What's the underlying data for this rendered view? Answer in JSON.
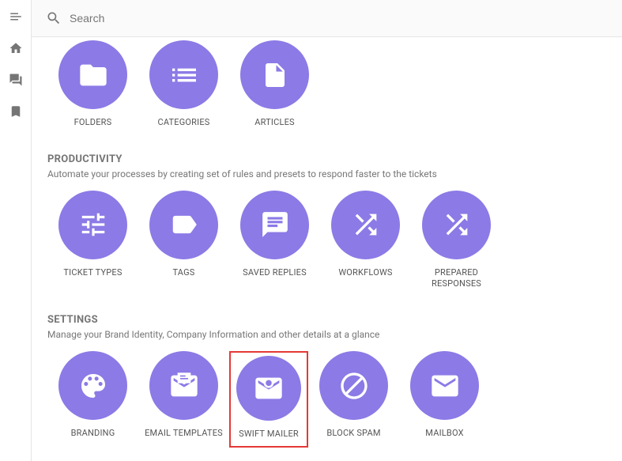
{
  "search": {
    "placeholder": "Search"
  },
  "colors": {
    "accent": "#8c7ae6",
    "highlight": "#e53935"
  },
  "top_tiles": [
    {
      "label": "FOLDERS",
      "icon": "folder-icon"
    },
    {
      "label": "CATEGORIES",
      "icon": "list-icon"
    },
    {
      "label": "ARTICLES",
      "icon": "file-icon"
    }
  ],
  "productivity": {
    "title": "PRODUCTIVITY",
    "subtitle": "Automate your processes by creating set of rules and presets to respond faster to the tickets",
    "tiles": [
      {
        "label": "TICKET TYPES",
        "icon": "sliders-icon"
      },
      {
        "label": "TAGS",
        "icon": "tag-icon"
      },
      {
        "label": "SAVED REPLIES",
        "icon": "chat-icon"
      },
      {
        "label": "WORKFLOWS",
        "icon": "shuffle-icon"
      },
      {
        "label": "PREPARED RESPONSES",
        "icon": "shuffle-icon"
      }
    ]
  },
  "settings": {
    "title": "SETTINGS",
    "subtitle": "Manage your Brand Identity, Company Information and other details at a glance",
    "tiles": [
      {
        "label": "BRANDING",
        "icon": "palette-icon"
      },
      {
        "label": "EMAIL TEMPLATES",
        "icon": "email-template-icon"
      },
      {
        "label": "SWIFT MAILER",
        "icon": "mail-gear-icon",
        "highlighted": true
      },
      {
        "label": "BLOCK SPAM",
        "icon": "block-icon"
      },
      {
        "label": "MAILBOX",
        "icon": "mail-icon"
      }
    ]
  }
}
